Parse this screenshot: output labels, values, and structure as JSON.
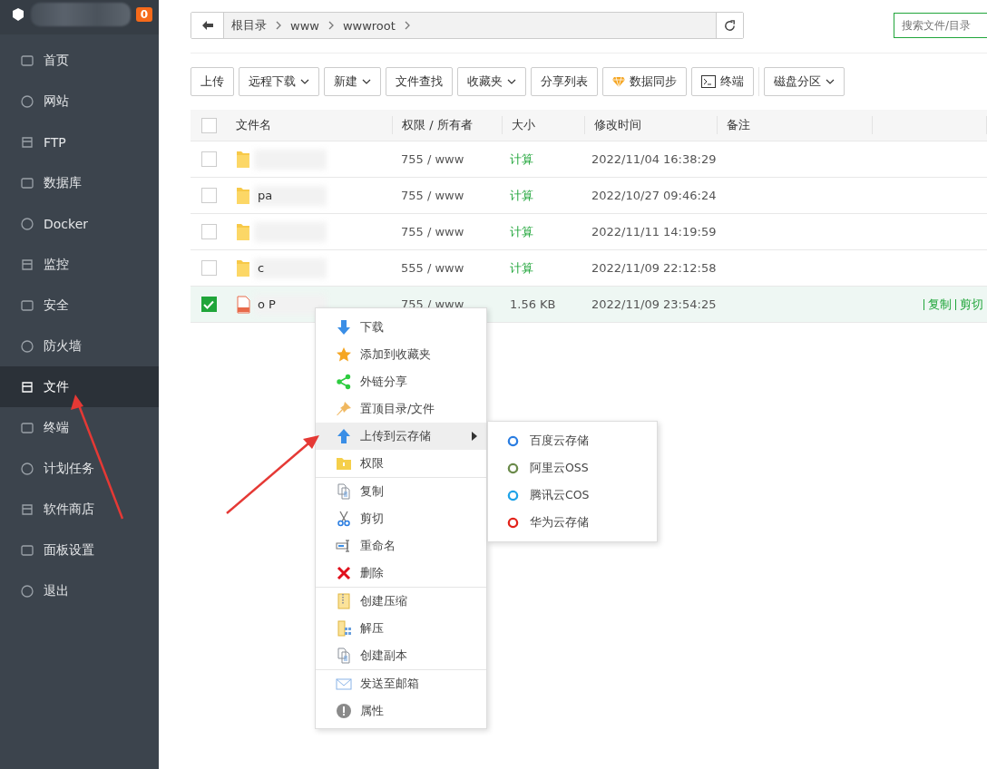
{
  "sidebar": {
    "badge": "0",
    "items": [
      {
        "label": "首页",
        "selected": false
      },
      {
        "label": "网站",
        "selected": false
      },
      {
        "label": "FTP",
        "selected": false
      },
      {
        "label": "数据库",
        "selected": false
      },
      {
        "label": "Docker",
        "selected": false
      },
      {
        "label": "监控",
        "selected": false
      },
      {
        "label": "安全",
        "selected": false
      },
      {
        "label": "防火墙",
        "selected": false
      },
      {
        "label": "文件",
        "selected": true
      },
      {
        "label": "终端",
        "selected": false
      },
      {
        "label": "计划任务",
        "selected": false
      },
      {
        "label": "软件商店",
        "selected": false
      },
      {
        "label": "面板设置",
        "selected": false
      },
      {
        "label": "退出",
        "selected": false
      }
    ]
  },
  "breadcrumb": [
    "根目录",
    "www",
    "wwwroot"
  ],
  "search": {
    "placeholder": "搜索文件/目录"
  },
  "toolbar": [
    {
      "label": "上传",
      "kind": "plain"
    },
    {
      "label": "远程下载",
      "kind": "dropdown"
    },
    {
      "label": "新建",
      "kind": "dropdown"
    },
    {
      "label": "文件查找",
      "kind": "plain"
    },
    {
      "label": "收藏夹",
      "kind": "dropdown"
    },
    {
      "label": "分享列表",
      "kind": "plain"
    },
    {
      "label": "数据同步",
      "kind": "sync"
    },
    {
      "label": "终端",
      "kind": "terminal"
    },
    {
      "label": "磁盘分区",
      "kind": "dropdown"
    }
  ],
  "table": {
    "all_checked": false,
    "columns": [
      "文件名",
      "权限 / 所有者",
      "大小",
      "修改时间",
      "备注"
    ],
    "rows": [
      {
        "kind": "folder",
        "name": "",
        "perm": "755 / www",
        "size": "计算",
        "size_clickable": true,
        "time": "2022/11/04 16:38:29",
        "checked": false,
        "actions": []
      },
      {
        "kind": "folder",
        "name": "pa",
        "perm": "755 / www",
        "size": "计算",
        "size_clickable": true,
        "time": "2022/10/27 09:46:24",
        "checked": false,
        "actions": []
      },
      {
        "kind": "folder",
        "name": "",
        "perm": "755 / www",
        "size": "计算",
        "size_clickable": true,
        "time": "2022/11/11 14:19:59",
        "checked": false,
        "actions": []
      },
      {
        "kind": "folder",
        "name": "c",
        "perm": "555 / www",
        "size": "计算",
        "size_clickable": true,
        "time": "2022/11/09 22:12:58",
        "checked": false,
        "actions": []
      },
      {
        "kind": "file",
        "name": "o P",
        "perm": "755 / www",
        "size": "1.56 KB",
        "size_clickable": false,
        "time": "2022/11/09 23:54:25",
        "checked": true,
        "actions": [
          "复制",
          "剪切"
        ]
      }
    ]
  },
  "context_menu": {
    "groups": [
      [
        {
          "label": "下载",
          "selected": false
        },
        {
          "label": "添加到收藏夹",
          "selected": false
        },
        {
          "label": "外链分享",
          "selected": false
        },
        {
          "label": "置顶目录/文件",
          "selected": false
        },
        {
          "label": "上传到云存储",
          "selected": true,
          "submenu": [
            "百度云存储",
            "阿里云OSS",
            "腾讯云COS",
            "华为云存储"
          ]
        },
        {
          "label": "权限",
          "selected": false
        }
      ],
      [
        {
          "label": "复制",
          "selected": false
        },
        {
          "label": "剪切",
          "selected": false
        },
        {
          "label": "重命名",
          "selected": false
        },
        {
          "label": "删除",
          "selected": false
        }
      ],
      [
        {
          "label": "创建压缩",
          "selected": false
        },
        {
          "label": "解压",
          "selected": false
        },
        {
          "label": "创建副本",
          "selected": false
        }
      ],
      [
        {
          "label": "发送至邮箱",
          "selected": false
        },
        {
          "label": "属性",
          "selected": false
        }
      ]
    ]
  }
}
